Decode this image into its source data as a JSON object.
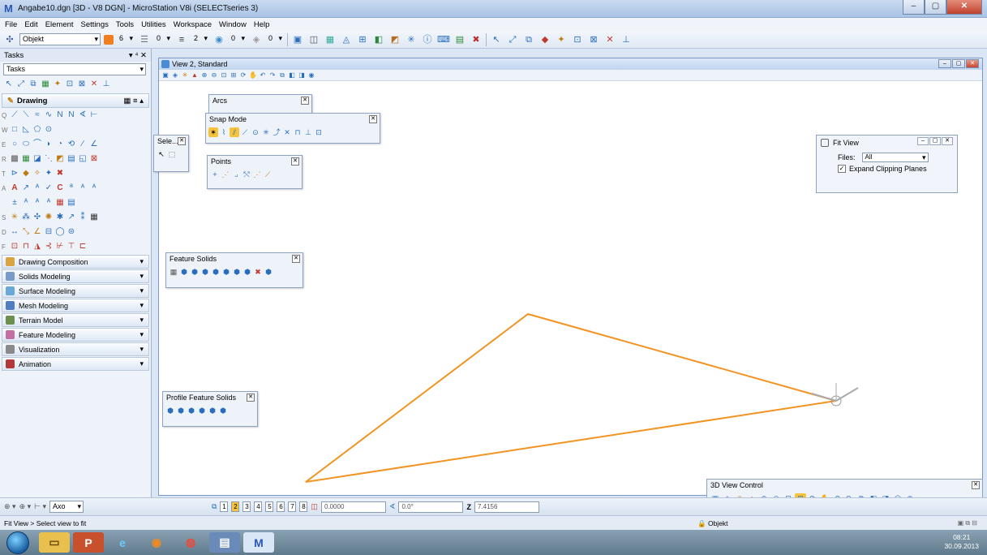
{
  "window": {
    "title": "Angabe10.dgn [3D - V8 DGN] - MicroStation V8i (SELECTseries 3)",
    "min_label": "–",
    "max_label": "▢",
    "close_label": "✕"
  },
  "menu": [
    "File",
    "Edit",
    "Element",
    "Settings",
    "Tools",
    "Utilities",
    "Workspace",
    "Window",
    "Help"
  ],
  "attributes": {
    "element_type": "Objekt",
    "color_value": "6",
    "style_value": "0",
    "weight_value": "2",
    "transparency_value": "0",
    "priority_value": "0"
  },
  "tasks": {
    "title": "Tasks",
    "selector": "Tasks",
    "drawing_group": "Drawing",
    "categories": [
      {
        "label": "Drawing Composition",
        "color": "#d9a441"
      },
      {
        "label": "Solids Modeling",
        "color": "#7a9bc9"
      },
      {
        "label": "Surface Modeling",
        "color": "#6aa8d8"
      },
      {
        "label": "Mesh Modeling",
        "color": "#4f7fc2"
      },
      {
        "label": "Terrain Model",
        "color": "#6b8f4e"
      },
      {
        "label": "Feature Modeling",
        "color": "#c26fa1"
      },
      {
        "label": "Visualization",
        "color": "#8a8a8a"
      },
      {
        "label": "Animation",
        "color": "#b33a3a"
      }
    ]
  },
  "view": {
    "title": "View 2, Standard"
  },
  "toolboxes": {
    "arcs": "Arcs",
    "snap_mode": "Snap Mode",
    "select": "Sele...",
    "points": "Points",
    "feature_solids": "Feature Solids",
    "profile_feature_solids": "Profile Feature Solids",
    "view_control_3d": "3D View Control"
  },
  "fit_view": {
    "title": "Fit View",
    "files_label": "Files:",
    "files_value": "All",
    "expand_label": "Expand Clipping Planes",
    "expand_checked": true
  },
  "bottom_bar": {
    "view_mode": "Axo",
    "view_numbers": [
      "1",
      "2",
      "3",
      "4",
      "5",
      "6",
      "7",
      "8"
    ],
    "active_view": "2",
    "x_value": "0.0000",
    "angle_value": "0.0°",
    "z_label": "Z",
    "z_value": "7.4156"
  },
  "status": {
    "prompt": "Fit View > Select view to fit",
    "level": "Objekt"
  },
  "clock": {
    "time": "08:21",
    "date": "30.09.2013"
  },
  "colors": {
    "shape_line": "#f39322",
    "accent": "#2a57b8"
  }
}
